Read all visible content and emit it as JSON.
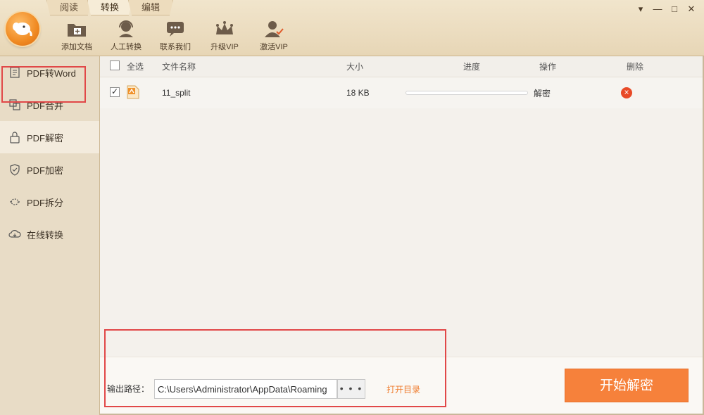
{
  "tabs": [
    {
      "label": "阅读"
    },
    {
      "label": "转换"
    },
    {
      "label": "编辑"
    }
  ],
  "toolbar": [
    {
      "label": "添加文档",
      "icon": "folder-add-icon"
    },
    {
      "label": "人工转换",
      "icon": "headset-icon"
    },
    {
      "label": "联系我们",
      "icon": "chat-icon"
    },
    {
      "label": "升级VIP",
      "icon": "crown-icon"
    },
    {
      "label": "激活VIP",
      "icon": "user-activate-icon"
    }
  ],
  "window": {
    "menu": "▾",
    "minimize": "—",
    "maximize": "□",
    "close": "✕"
  },
  "sidebar": {
    "items": [
      {
        "label": "PDF转Word",
        "icon": "word-doc-icon"
      },
      {
        "label": "PDF合并",
        "icon": "merge-icon"
      },
      {
        "label": "PDF解密",
        "icon": "unlock-icon"
      },
      {
        "label": "PDF加密",
        "icon": "shield-icon"
      },
      {
        "label": "PDF拆分",
        "icon": "split-icon"
      },
      {
        "label": "在线转换",
        "icon": "cloud-icon"
      }
    ],
    "active_index": 2
  },
  "table": {
    "headers": {
      "select_all": "全选",
      "name": "文件名称",
      "size": "大小",
      "progress": "进度",
      "action": "操作",
      "delete": "删除"
    },
    "rows": [
      {
        "name": "11_split",
        "size": "18 KB",
        "progress": 0,
        "action": "解密",
        "checked": true
      }
    ]
  },
  "bottom": {
    "output_label": "输出路径：",
    "output_path": "C:\\Users\\Administrator\\AppData\\Roaming",
    "browse": "• • •",
    "open_dir": "打开目录",
    "start": "开始解密"
  },
  "colors": {
    "accent": "#f6813b",
    "highlight": "#e14848",
    "delete": "#e84a27"
  }
}
